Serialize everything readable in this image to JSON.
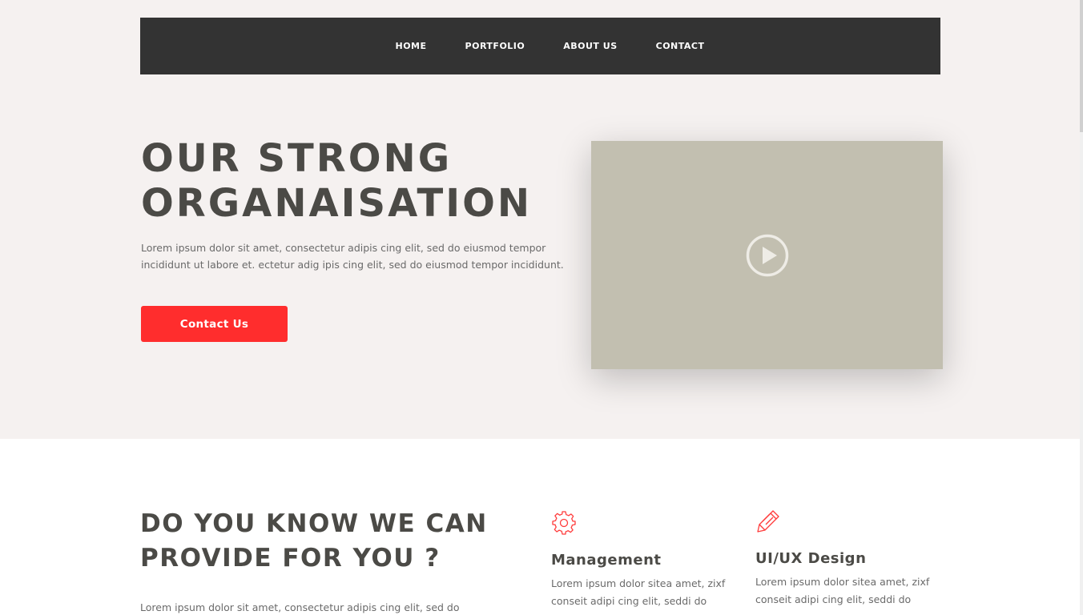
{
  "nav": {
    "items": [
      "HOME",
      "PORTFOLIO",
      "ABOUT US",
      "CONTACT"
    ]
  },
  "hero": {
    "title_line1": "OUR STRONG",
    "title_line2": "ORGANAISATION",
    "text_line1": "Lorem ipsum dolor sit amet, consectetur adipis cing elit, sed do eiusmod tempor",
    "text_line2": "incididunt ut labore et. ectetur adig ipis cing elit, sed do eiusmod tempor incididunt.",
    "button_label": "Contact Us",
    "video_icon": "play-circle-icon"
  },
  "services": {
    "title_line1": "DO YOU KNOW WE CAN",
    "title_line2": "PROVIDE FOR YOU ?",
    "text": "Lorem ipsum dolor sit amet, consectetur adipis cing elit, sed do",
    "items": [
      {
        "icon": "gear-icon",
        "title": "Management",
        "text_line1": "Lorem ipsum dolor sitea amet, zixf",
        "text_line2": "conseit adipi cing elit, seddi do"
      },
      {
        "icon": "pencil-icon",
        "title": "UI/UX Design",
        "text_line1": "Lorem ipsum dolor sitea amet, zixf",
        "text_line2": "conseit adipi cing elit, seddi do"
      }
    ]
  },
  "colors": {
    "accent": "#ff2d2d",
    "nav_bg": "#333333",
    "hero_bg": "#f5f1f0",
    "video_bg": "#c2bfb0",
    "heading": "#4b4a46"
  }
}
